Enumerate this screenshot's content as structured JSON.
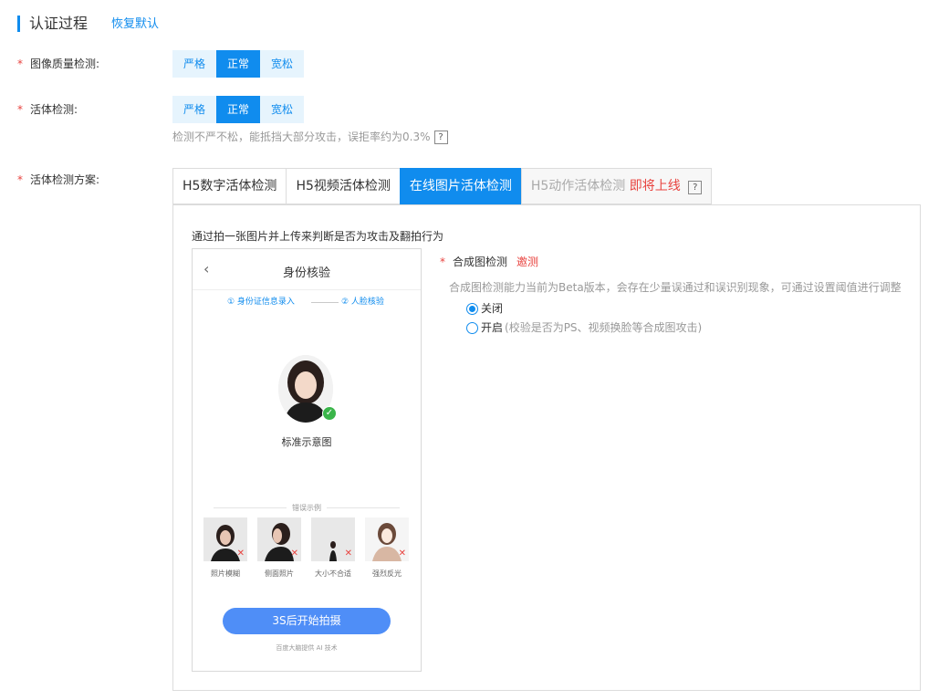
{
  "header": {
    "title": "认证过程",
    "reset_link": "恢复默认"
  },
  "image_quality": {
    "required_mark": "*",
    "label": "图像质量检测:",
    "options": [
      "严格",
      "正常",
      "宽松"
    ],
    "selected": "正常"
  },
  "liveness": {
    "required_mark": "*",
    "label": "活体检测:",
    "options": [
      "严格",
      "正常",
      "宽松"
    ],
    "selected": "正常",
    "hint": "检测不严不松，能抵挡大部分攻击，误拒率约为0.3%",
    "help_icon": "?"
  },
  "scheme": {
    "required_mark": "*",
    "label": "活体检测方案:",
    "tabs": [
      {
        "label": "H5数字活体检测"
      },
      {
        "label": "H5视频活体检测"
      },
      {
        "label": "在线图片活体检测"
      },
      {
        "label": "H5动作活体检测",
        "suffix": "即将上线",
        "help_icon": "?"
      }
    ],
    "active_tab": "在线图片活体检测"
  },
  "panel": {
    "description": "通过拍一张图片并上传来判断是否为攻击及翻拍行为",
    "phone": {
      "back_icon": "‹",
      "title": "身份核验",
      "steps": [
        "① 身份证信息录入",
        "② 人脸核验"
      ],
      "sample_label": "标准示意图",
      "error_title": "错误示例",
      "error_samples": [
        "照片模糊",
        "侧面照片",
        "大小不合适",
        "强烈反光"
      ],
      "start_button": "3S后开始拍摄",
      "powered_by": "百度大脑提供 AI 技术"
    },
    "synthesis": {
      "required_mark": "*",
      "label": "合成图检测",
      "badge": "邀测",
      "description": "合成图检测能力当前为Beta版本，会存在少量误通过和误识别现象，可通过设置阈值进行调整",
      "options": [
        {
          "label": "关闭",
          "note": ""
        },
        {
          "label": "开启",
          "note": "(校验是否为PS、视频换脸等合成图攻击)"
        }
      ],
      "selected": "关闭"
    }
  },
  "colors": {
    "accent": "#108cee",
    "accent_light": "#e6f4fd",
    "danger": "#e8433f",
    "button_blue": "#4f8ef7",
    "success": "#3ab54a"
  }
}
